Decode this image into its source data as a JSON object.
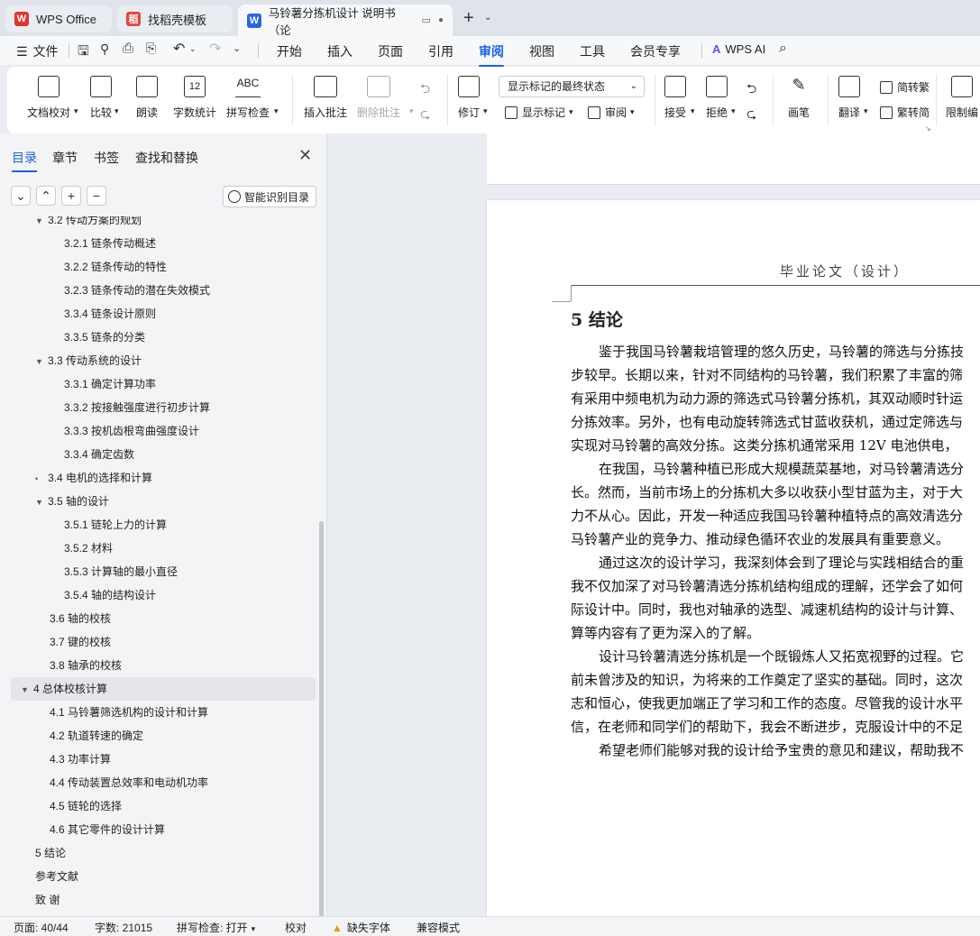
{
  "tabs": [
    {
      "label": "WPS Office",
      "icon": "wps-logo-icon"
    },
    {
      "label": "找稻壳模板",
      "icon": "docer-icon"
    },
    {
      "label": "马铃薯分拣机设计 说明书（论",
      "icon": "wps-writer-icon"
    }
  ],
  "menu": {
    "file": "文件",
    "items": [
      "开始",
      "插入",
      "页面",
      "引用",
      "审阅",
      "视图",
      "工具",
      "会员专享"
    ],
    "ai": "WPS AI",
    "active": "审阅"
  },
  "ribbon": {
    "doc_check": "文档校对",
    "compare": "比较",
    "read_aloud": "朗读",
    "word_count": "字数统计",
    "spell_check": "拼写检查",
    "insert_comment": "插入批注",
    "delete_comment": "删除批注",
    "revise": "修订",
    "markup_select": "显示标记的最终状态",
    "show_markup": "显示标记",
    "review": "审阅",
    "accept": "接受",
    "reject": "拒绝",
    "pen": "画笔",
    "translate": "翻译",
    "to_traditional": "简转繁",
    "to_simplified": "繁转简",
    "restrict": "限制编",
    "word_count_num": "12",
    "spell_abc": "ABC"
  },
  "sidebar": {
    "tabs": [
      "目录",
      "章节",
      "书签",
      "查找和替换"
    ],
    "smart_toc": "智能识别目录",
    "toc": [
      {
        "label": "3.2  传动方案的规划",
        "level": 1,
        "caret": true
      },
      {
        "label": "3.2.1  链条传动概述",
        "level": 2
      },
      {
        "label": "3.2.2  链条传动的特性",
        "level": 2
      },
      {
        "label": "3.2.3  链条传动的潜在失效模式",
        "level": 2
      },
      {
        "label": "3.3.4  链条设计原则",
        "level": 2
      },
      {
        "label": "3.3.5  链条的分类",
        "level": 2
      },
      {
        "label": "3.3 传动系统的设计",
        "level": 1,
        "caret": true
      },
      {
        "label": "3.3.1 确定计算功率",
        "level": 2
      },
      {
        "label": "3.3.2 按接触强度进行初步计算",
        "level": 2
      },
      {
        "label": "3.3.3 按机齿根弯曲强度设计",
        "level": 2
      },
      {
        "label": "3.3.4 确定齿数",
        "level": 2
      },
      {
        "label": "3.4 电机的选择和计算",
        "level": 1,
        "dot": true
      },
      {
        "label": "3.5 轴的设计",
        "level": 1,
        "caret": true
      },
      {
        "label": "3.5.1 链轮上力的计算",
        "level": 2
      },
      {
        "label": "3.5.2 材料",
        "level": 2
      },
      {
        "label": "3.5.3 计算轴的最小直径",
        "level": 2
      },
      {
        "label": "3.5.4 轴的结构设计",
        "level": 2
      },
      {
        "label": "3.6 轴的校核",
        "level": 1
      },
      {
        "label": "3.7 键的校核",
        "level": 1
      },
      {
        "label": "3.8 轴承的校核",
        "level": 1
      },
      {
        "label": "4  总体校核计算",
        "level": 0,
        "caret": true,
        "highlight": true
      },
      {
        "label": "4.1  马铃薯筛选机构的设计和计算",
        "level": 1
      },
      {
        "label": "4.2  轨道转速的确定",
        "level": 1
      },
      {
        "label": "4.3  功率计算",
        "level": 1
      },
      {
        "label": "4.4  传动装置总效率和电动机功率",
        "level": 1
      },
      {
        "label": "4.5  链轮的选择",
        "level": 1
      },
      {
        "label": "4.6 其它零件的设计计算",
        "level": 1
      },
      {
        "label": "5 结论",
        "level": 0
      },
      {
        "label": "参考文献",
        "level": 0
      },
      {
        "label": "致    谢",
        "level": 0
      }
    ]
  },
  "document": {
    "header": "毕业论文（设计）",
    "title": "5 结论",
    "lines": [
      "鉴于我国马铃薯栽培管理的悠久历史，马铃薯的筛选与分拣技",
      "步较早。长期以来，针对不同结构的马铃薯，我们积累了丰富的筛",
      "有采用中频电机为动力源的筛选式马铃薯分拣机，其双动顺时针运",
      "分拣效率。另外，也有电动旋转筛选式甘蓝收获机，通过定筛选与",
      "实现对马铃薯的高效分拣。这类分拣机通常采用 12V 电池供电，",
      "在我国，马铃薯种植已形成大规模蔬菜基地，对马铃薯清选分",
      "长。然而，当前市场上的分拣机大多以收获小型甘蓝为主，对于大",
      "力不从心。因此，开发一种适应我国马铃薯种植特点的高效清选分",
      "马铃薯产业的竞争力、推动绿色循环农业的发展具有重要意义。",
      "通过这次的设计学习，我深刻体会到了理论与实践相结合的重",
      "我不仅加深了对马铃薯清选分拣机结构组成的理解，还学会了如何",
      "际设计中。同时，我也对轴承的选型、减速机结构的设计与计算、",
      "算等内容有了更为深入的了解。",
      "设计马铃薯清选分拣机是一个既锻炼人又拓宽视野的过程。它",
      "前未曾涉及的知识，为将来的工作奠定了坚实的基础。同时，这次",
      "志和恒心，使我更加端正了学习和工作的态度。尽管我的设计水平",
      "信，在老师和同学们的帮助下，我会不断进步，克服设计中的不足",
      "希望老师们能够对我的设计给予宝贵的意见和建议，帮助我不"
    ],
    "indent": [
      true,
      false,
      false,
      false,
      false,
      true,
      false,
      false,
      false,
      true,
      false,
      false,
      false,
      true,
      false,
      false,
      false,
      true
    ]
  },
  "status": {
    "page": "页面: 40/44",
    "words": "字数: 21015",
    "spell": "拼写检查: 打开",
    "proof": "校对",
    "missing_font": "缺失字体",
    "compat": "兼容模式"
  }
}
